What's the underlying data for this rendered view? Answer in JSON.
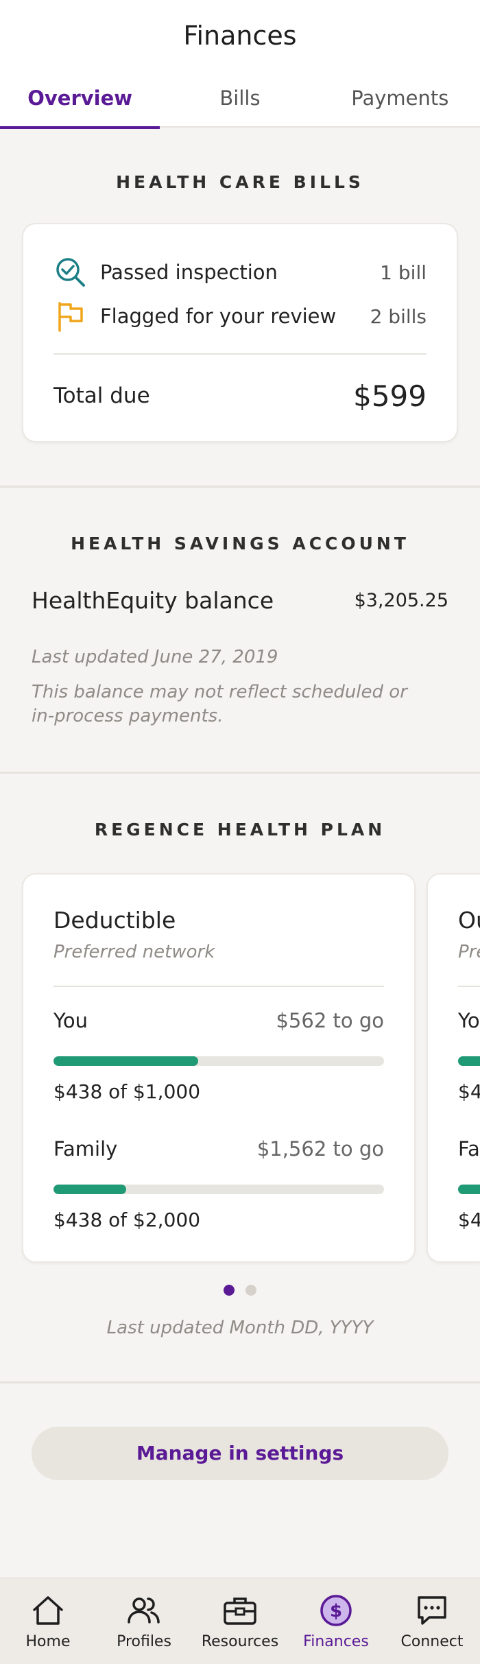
{
  "header": {
    "title": "Finances",
    "tabs": [
      {
        "label": "Overview",
        "active": true
      },
      {
        "label": "Bills",
        "active": false
      },
      {
        "label": "Payments",
        "active": false
      }
    ]
  },
  "health_care_bills": {
    "heading": "HEALTH CARE BILLS",
    "rows": [
      {
        "icon": "magnifier-check-icon",
        "label": "Passed inspection",
        "count": "1 bill"
      },
      {
        "icon": "flag-icon",
        "label": "Flagged for your review",
        "count": "2 bills"
      }
    ],
    "total_label": "Total due",
    "total_value": "$599"
  },
  "hsa": {
    "heading": "HEALTH SAVINGS ACCOUNT",
    "name": "HealthEquity balance",
    "balance": "$3,205.25",
    "last_updated": "Last updated June 27, 2019",
    "disclaimer": "This balance may not reflect scheduled or in-process payments."
  },
  "plan": {
    "heading": "REGENCE HEALTH PLAN",
    "cards": [
      {
        "title": "Deductible",
        "subtitle": "Preferred network",
        "rows": [
          {
            "label": "You",
            "to_go": "$562 to go",
            "amount": "$438 of $1,000",
            "progress": 0.438
          },
          {
            "label": "Family",
            "to_go": "$1,562 to go",
            "amount": "$438 of $2,000",
            "progress": 0.219
          }
        ]
      },
      {
        "title_partial": "Ou",
        "subtitle_partial": "Pre",
        "row_labels_partial": [
          "Yo",
          "Fa"
        ],
        "amount_partials": [
          "$4",
          "$4"
        ]
      }
    ],
    "pagination": {
      "count": 2,
      "active_index": 0
    },
    "last_updated": "Last updated Month DD, YYYY"
  },
  "manage_button_label": "Manage in settings",
  "bottom_nav": [
    {
      "icon": "home-icon",
      "label": "Home",
      "active": false
    },
    {
      "icon": "profiles-icon",
      "label": "Profiles",
      "active": false
    },
    {
      "icon": "briefcase-icon",
      "label": "Resources",
      "active": false
    },
    {
      "icon": "dollar-icon",
      "label": "Finances",
      "active": true
    },
    {
      "icon": "chat-icon",
      "label": "Connect",
      "active": false
    }
  ],
  "colors": {
    "accent": "#5a1a96",
    "progress": "#1f9a74",
    "check_icon": "#1d7f86",
    "flag_icon": "#f0a51c",
    "background": "#f5f4f2"
  }
}
